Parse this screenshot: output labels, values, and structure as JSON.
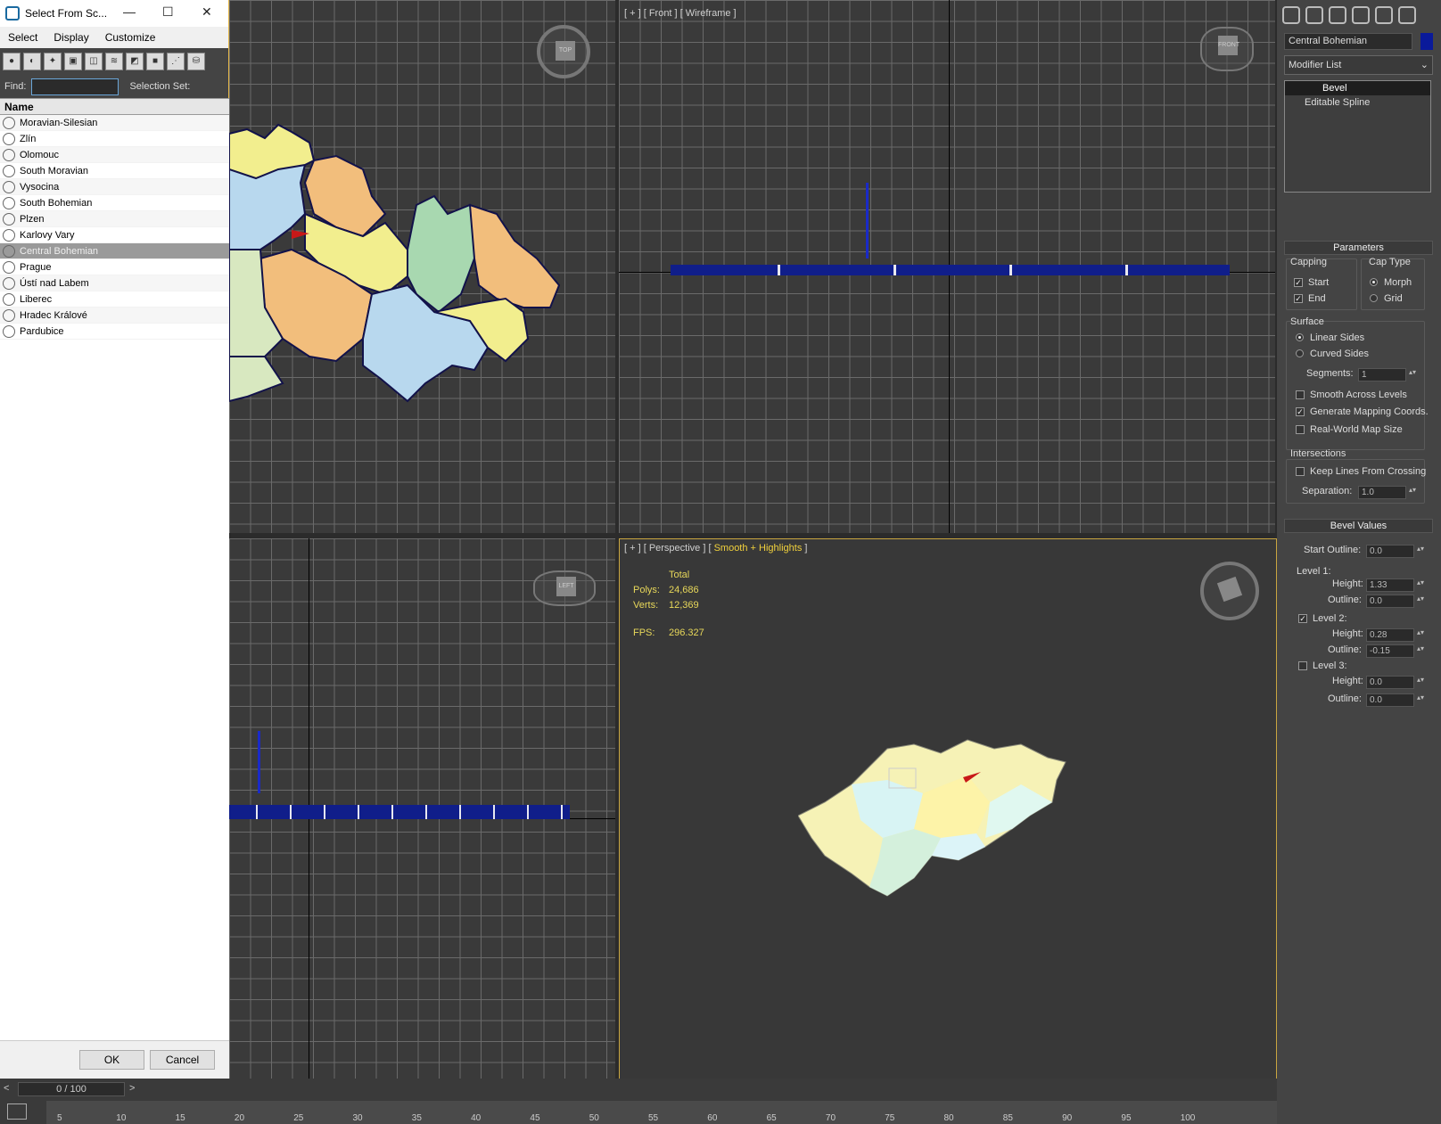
{
  "dialog": {
    "title": "Select From Sc...",
    "menu": [
      "Select",
      "Display",
      "Customize"
    ],
    "find_label": "Find:",
    "find_value": "",
    "selection_set_label": "Selection Set:",
    "list_header": "Name",
    "items": [
      "Moravian-Silesian",
      "Zlín",
      "Olomouc",
      "South Moravian",
      "Vysocina",
      "South Bohemian",
      "Plzen",
      "Karlovy Vary",
      "Central Bohemian",
      "Prague",
      "Ústí nad Labem",
      "Liberec",
      "Hradec Králové",
      "Pardubice"
    ],
    "selected_item": "Central Bohemian",
    "ok": "OK",
    "cancel": "Cancel"
  },
  "viewports": {
    "front_label": "[ + ] [ Front ] [ Wireframe ]",
    "persp_label_a": "[ + ] [ Perspective ] [",
    "persp_label_hl": " Smooth + Highlights ",
    "persp_label_b": "]",
    "stats": {
      "total": "Total",
      "polys_label": "Polys:",
      "polys": "24,686",
      "verts_label": "Verts:",
      "verts": "12,369",
      "fps_label": "FPS:",
      "fps": "296.327"
    },
    "viewcube_top": "TOP",
    "viewcube_front": "FRONT",
    "viewcube_left": "LEFT"
  },
  "panel": {
    "object_name": "Central Bohemian",
    "object_color": "#0a1a9a",
    "modifier_list": "Modifier List",
    "stack": [
      "Bevel",
      "Editable Spline"
    ],
    "parameters": {
      "title": "Parameters",
      "capping": "Capping",
      "start": "Start",
      "end": "End",
      "cap_type": "Cap Type",
      "morph": "Morph",
      "grid": "Grid",
      "surface": "Surface",
      "linear_sides": "Linear Sides",
      "curved_sides": "Curved Sides",
      "segments_label": "Segments:",
      "segments": "1",
      "smooth_across": "Smooth Across Levels",
      "gen_mapping": "Generate Mapping Coords.",
      "real_world": "Real-World Map Size",
      "intersections": "Intersections",
      "keep_lines": "Keep Lines From Crossing",
      "separation_label": "Separation:",
      "separation": "1.0"
    },
    "bevel": {
      "title": "Bevel Values",
      "start_outline_label": "Start Outline:",
      "start_outline": "0.0",
      "level1": "Level 1:",
      "height_label": "Height:",
      "outline_label": "Outline:",
      "l1_height": "1.33",
      "l1_outline": "0.0",
      "level2": "Level 2:",
      "l2_height": "0.28",
      "l2_outline": "-0.15",
      "level3": "Level 3:",
      "l3_height": "0.0",
      "l3_outline": "0.0"
    }
  },
  "timeline": {
    "frame": "0 / 100",
    "ticks": [
      "5",
      "10",
      "15",
      "20",
      "25",
      "30",
      "35",
      "40",
      "45",
      "50",
      "55",
      "60",
      "65",
      "70",
      "75",
      "80",
      "85",
      "90",
      "95",
      "100"
    ]
  }
}
